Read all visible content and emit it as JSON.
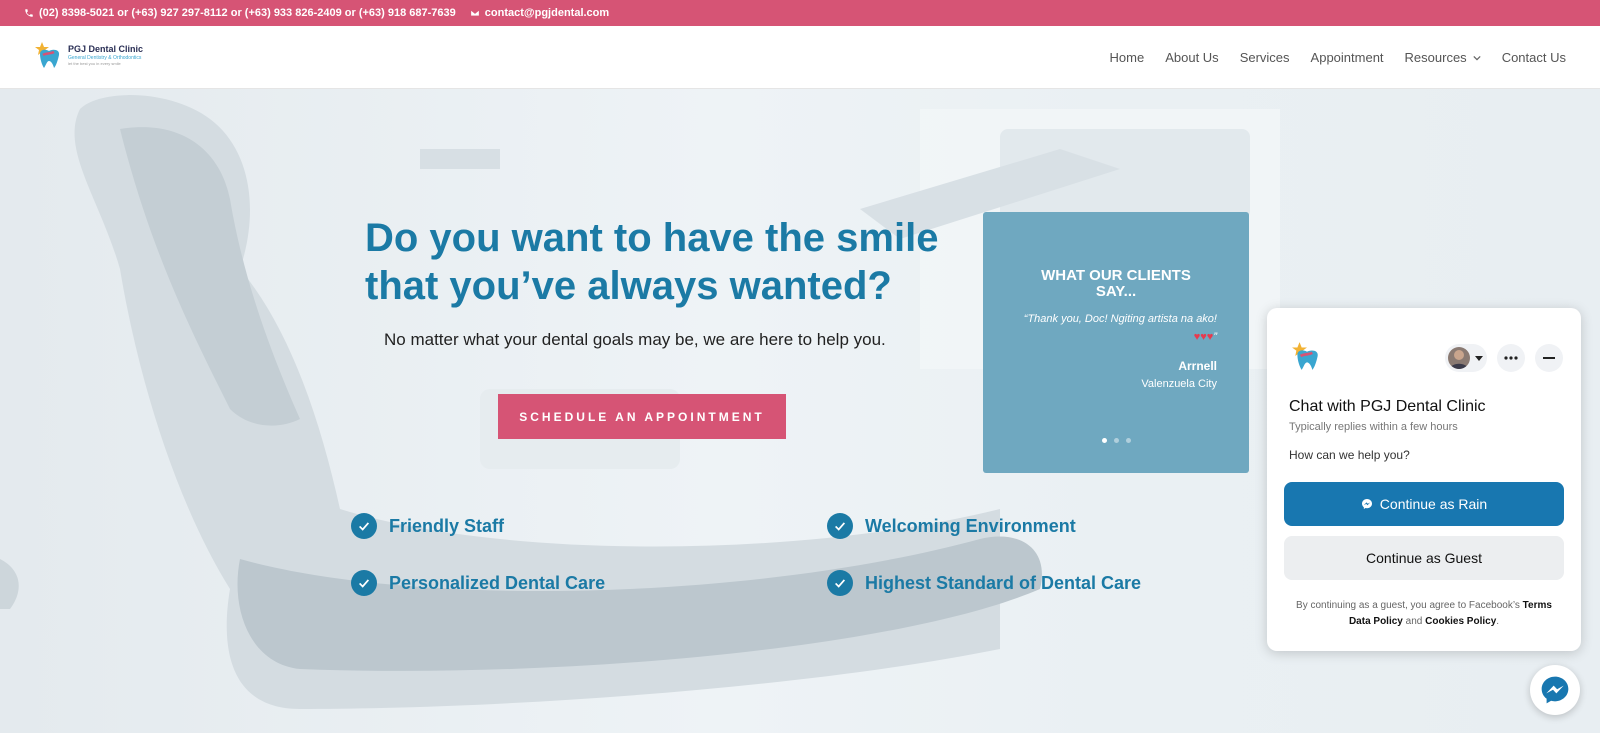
{
  "topbar": {
    "phones": "(02) 8398-5021 or (+63) 927 297-8112 or (+63) 933 826-2409 or (+63) 918 687-7639",
    "email": "contact@pgjdental.com"
  },
  "logo": {
    "name": "PGJ Dental Clinic",
    "sub": "General Dentistry & Orthodontics",
    "tagline": "let the best you in every smile"
  },
  "nav": {
    "items": [
      "Home",
      "About Us",
      "Services",
      "Appointment",
      "Resources",
      "Contact Us"
    ]
  },
  "hero": {
    "headline_line1": "Do you want to have the smile",
    "headline_line2": "that you’ve always wanted?",
    "subline": "No matter what your dental goals may be, we are here to help you.",
    "cta": "SCHEDULE AN APPOINTMENT"
  },
  "testimonial": {
    "title": "WHAT OUR CLIENTS SAY...",
    "quote_open": "“Thank you, Doc! Ngiting artista na ako! ",
    "hearts": "♥♥♥",
    "quote_close": "”",
    "name": "Arrnell",
    "location": "Valenzuela City",
    "slide_count": 3,
    "active_slide": 1
  },
  "features": [
    "Friendly Staff",
    "Welcoming Environment",
    "Personalized Dental Care",
    "Highest Standard of Dental Care"
  ],
  "chat": {
    "title": "Chat with PGJ Dental Clinic",
    "reply_time": "Typically replies within a few hours",
    "help": "How can we help you?",
    "continue_as": "Continue as Rain",
    "continue_guest": "Continue as Guest",
    "legal_prefix": "By continuing as a guest, you agree to Facebook’s ",
    "terms": "Terms",
    "data_policy": "Data Policy",
    "and": " and ",
    "cookies": "Cookies Policy",
    "period": "."
  },
  "colors": {
    "brand_pink": "#d65475",
    "brand_blue": "#1b7aa5",
    "messenger_blue": "#1877b0"
  }
}
